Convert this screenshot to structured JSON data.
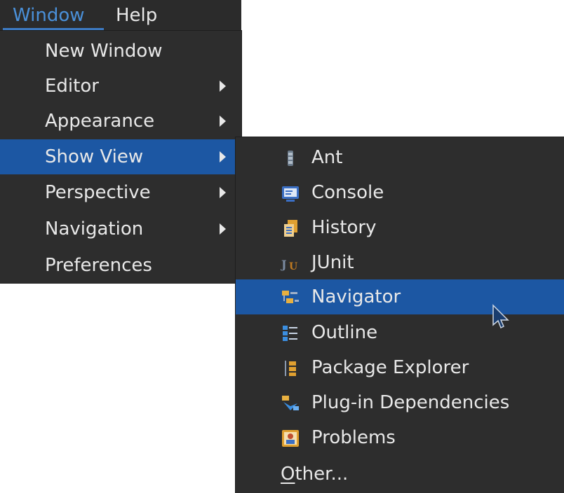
{
  "menubar": {
    "items": [
      {
        "label": "Window",
        "active": true
      },
      {
        "label": "Help",
        "active": false
      }
    ]
  },
  "window_menu": {
    "items": [
      {
        "label": "New Window",
        "has_submenu": false
      },
      {
        "label": "Editor",
        "has_submenu": true
      },
      {
        "label": "Appearance",
        "has_submenu": true
      },
      {
        "label": "Show View",
        "has_submenu": true,
        "highlighted": true
      },
      {
        "label": "Perspective",
        "has_submenu": true
      },
      {
        "label": "Navigation",
        "has_submenu": true
      },
      {
        "label": "Preferences",
        "has_submenu": false
      }
    ]
  },
  "show_view_menu": {
    "items": [
      {
        "label": "Ant",
        "icon": "ant-icon"
      },
      {
        "label": "Console",
        "icon": "console-icon"
      },
      {
        "label": "History",
        "icon": "history-icon"
      },
      {
        "label": "JUnit",
        "icon": "junit-icon"
      },
      {
        "label": "Navigator",
        "icon": "navigator-icon",
        "highlighted": true
      },
      {
        "label": "Outline",
        "icon": "outline-icon"
      },
      {
        "label": "Package Explorer",
        "icon": "package-explorer-icon"
      },
      {
        "label": "Plug-in Dependencies",
        "icon": "plugin-dependencies-icon"
      },
      {
        "label": "Problems",
        "icon": "problems-icon"
      }
    ],
    "other": {
      "mnemonic": "O",
      "rest": "ther..."
    }
  },
  "colors": {
    "menu_bg": "#2d2d2d",
    "highlight": "#1c57a3",
    "active_menubar_text": "#4a90d9",
    "text": "#e8e8e8"
  }
}
